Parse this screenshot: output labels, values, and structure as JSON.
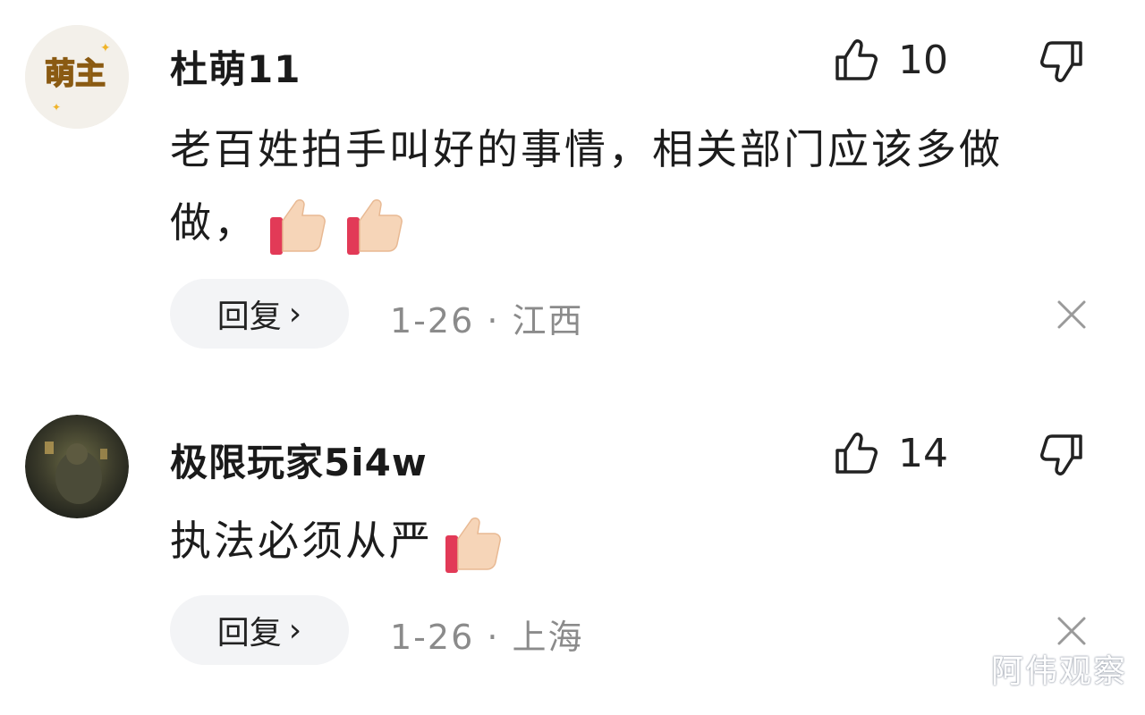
{
  "comments": [
    {
      "username": "杜萌11",
      "avatar_badge": "萌主",
      "likes": "10",
      "content": "老百姓拍手叫好的事情，相关部门应该多做做，",
      "emoji": "thumbs-up-emoji",
      "emoji_count": 2,
      "reply_label": "回复",
      "reply_chevron": "›",
      "date": "1-26",
      "separator": "·",
      "location": "江西"
    },
    {
      "username": "极限玩家5i4w",
      "likes": "14",
      "content": "执法必须从严",
      "emoji": "thumbs-up-emoji",
      "emoji_count": 1,
      "reply_label": "回复",
      "reply_chevron": "›",
      "date": "1-26",
      "separator": "·",
      "location": "上海"
    }
  ],
  "icons": {
    "like": "thumbs-up-outline-icon",
    "dislike": "thumbs-down-outline-icon",
    "close": "close-icon"
  },
  "colors": {
    "avatar_badge_yellow": "#f7c531",
    "reply_button_bg": "#f3f4f6",
    "meta_gray": "#8b8b8b"
  },
  "watermark": "阿伟观察"
}
